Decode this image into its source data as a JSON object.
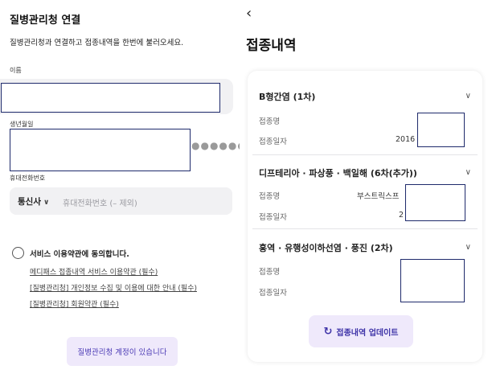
{
  "left": {
    "title": "질병관리청 연결",
    "subtitle": "질병관리청과 연결하고 접종내역을 한번에 불러오세요.",
    "name_label": "이름",
    "birth_label": "생년월일",
    "birth_mask": "●●●●●●",
    "phone_label": "휴대전화번호",
    "carrier": "통신사",
    "phone_placeholder": "휴대전화번호 (– 제외)",
    "agree_label": "서비스 이용약관에 동의합니다.",
    "terms": [
      "메디패스 접종내역 서비스 이용약관 (필수)",
      "[질병관리청] 개인정보 수집 및 이용에 대한 안내 (필수)",
      "[질병관리청] 회원약관 (필수)"
    ],
    "account_button": "질병관리청 계정이 있습니다"
  },
  "right": {
    "back": "‹",
    "title": "접종내역",
    "label_name": "접종명",
    "label_date": "접종일자",
    "vaccines": [
      {
        "title": "B형간염 (1차)",
        "name_value": "",
        "date_value": "2016"
      },
      {
        "title": "디프테리아 · 파상풍 · 백일해 (6차(추가))",
        "name_value": "부스트릭스프",
        "date_value": "2"
      },
      {
        "title": "홍역 · 유행성이하선염 · 풍진 (2차)",
        "name_value": "",
        "date_value": ""
      }
    ],
    "update_button": "접종내역 업데이트"
  }
}
